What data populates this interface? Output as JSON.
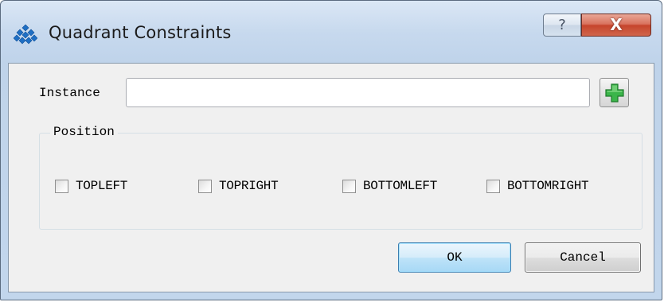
{
  "window": {
    "title": "Quadrant Constraints",
    "help_glyph": "?",
    "close_glyph": "X",
    "app_icon": "diamond-cluster-icon",
    "accent_close": "#c6452c"
  },
  "form": {
    "instance_label": "Instance",
    "instance_value": "",
    "add_icon": "plus-icon",
    "add_icon_color": "#3bb54a"
  },
  "position": {
    "title": "Position",
    "options": [
      {
        "label": "TOPLEFT",
        "checked": false
      },
      {
        "label": "TOPRIGHT",
        "checked": false
      },
      {
        "label": "BOTTOMLEFT",
        "checked": false
      },
      {
        "label": "BOTTOMRIGHT",
        "checked": false
      }
    ]
  },
  "buttons": {
    "ok": "OK",
    "cancel": "Cancel"
  }
}
